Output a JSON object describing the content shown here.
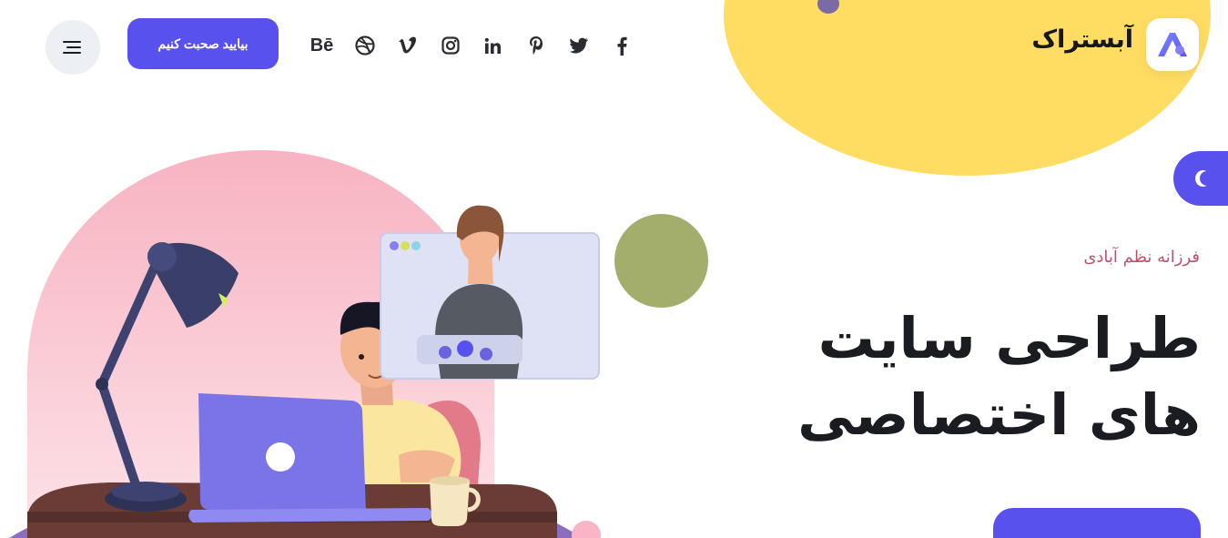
{
  "brand": {
    "name": "آبستراک",
    "logo_icon": "abstrak-logo-icon",
    "accent_color": "#5951ee"
  },
  "header": {
    "cta_label": "بیایید صحبت کنیم",
    "menu_icon": "hamburger-menu-icon",
    "social": [
      {
        "name": "behance",
        "text": "Bē"
      },
      {
        "name": "dribbble"
      },
      {
        "name": "vimeo"
      },
      {
        "name": "instagram"
      },
      {
        "name": "linkedin"
      },
      {
        "name": "pinterest"
      },
      {
        "name": "twitter"
      },
      {
        "name": "facebook"
      }
    ]
  },
  "theme_toggle": {
    "icon": "moon-icon"
  },
  "hero": {
    "subtitle": "فرزانه نظم آبادی",
    "title": "طراحی سایت های اختصاصی",
    "illustration": "person-working-on-laptop-with-video-call-illustration"
  },
  "colors": {
    "yellow_blob": "#ffdc62",
    "green_dot": "#a3ae6c",
    "pink_arch": "#f7b6c4",
    "subtitle": "#c0506a"
  }
}
